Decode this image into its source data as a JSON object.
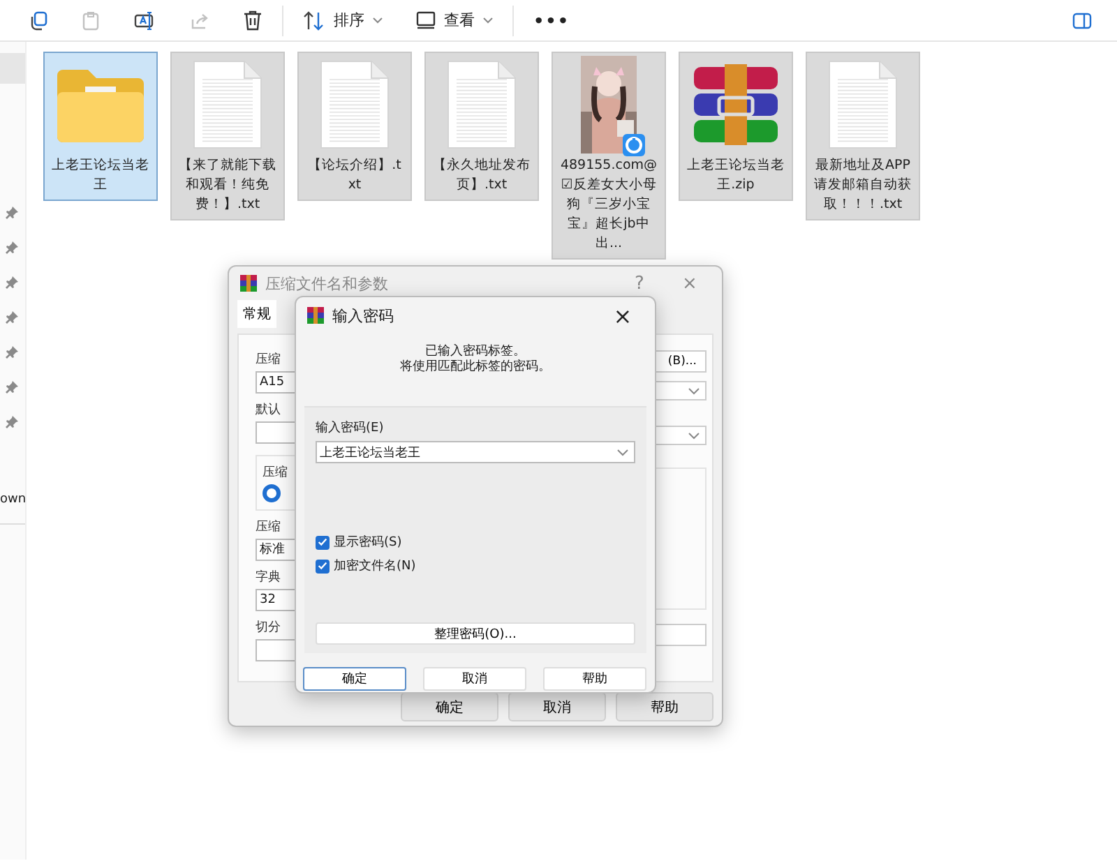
{
  "toolbar": {
    "items": [
      {
        "kind": "copy",
        "disabled": false
      },
      {
        "kind": "paste",
        "disabled": true
      },
      {
        "kind": "rename",
        "disabled": false
      },
      {
        "kind": "share",
        "disabled": true
      },
      {
        "kind": "delete",
        "disabled": false
      },
      {
        "kind": "sort",
        "label": "排序",
        "disabled": false
      },
      {
        "kind": "view",
        "label": "查看",
        "disabled": false
      },
      {
        "kind": "more",
        "label": "•••",
        "disabled": false
      }
    ],
    "details_pane": true
  },
  "sidebar": {
    "items": [
      {
        "pinned": true
      },
      {
        "pinned": true
      },
      {
        "pinned": true
      },
      {
        "pinned": true
      },
      {
        "pinned": true
      },
      {
        "pinned": true
      },
      {
        "pinned": true
      },
      {
        "label": "own",
        "pinned": false
      }
    ]
  },
  "files": [
    {
      "kind": "folder",
      "name": "上老王论坛当老王",
      "selected": true
    },
    {
      "kind": "text",
      "name": "【来了就能下载和观看！纯免费！】.txt",
      "selected": false
    },
    {
      "kind": "text",
      "name": "【论坛介绍】.txt",
      "selected": false
    },
    {
      "kind": "text",
      "name": "【永久地址发布页】.txt",
      "selected": false
    },
    {
      "kind": "video",
      "name": "489155.com@☑反差女大小母狗『三岁小宝宝』超长jb中出...",
      "selected": false
    },
    {
      "kind": "archive",
      "name": "上老王论坛当老王.zip",
      "selected": false
    },
    {
      "kind": "text",
      "name": "最新地址及APP请发邮箱自动获取！！！.txt",
      "selected": false
    }
  ],
  "archive_dialog": {
    "title": "压缩文件名和参数",
    "help": "?",
    "close": "×",
    "tab": "常规",
    "labels": [
      "压缩",
      "默认",
      "压缩",
      "压缩",
      "字典",
      "切分"
    ],
    "archive_name": "A15",
    "radio_checked": true,
    "method": "标准",
    "dictionary": "32",
    "browse": "(B)...",
    "buttons": [
      "确定",
      "取消",
      "帮助"
    ]
  },
  "password_dialog": {
    "title": "输入密码",
    "close": "×",
    "message": [
      "已输入密码标签。",
      "将使用匹配此标签的密码。"
    ],
    "field_label": "输入密码(E)",
    "password": "上老王论坛当老王",
    "checkboxes": [
      {
        "label": "显示密码(S)",
        "checked": true
      },
      {
        "label": "加密文件名(N)",
        "checked": true
      }
    ],
    "organize": "整理密码(O)...",
    "buttons": [
      {
        "label": "确定",
        "default": true
      },
      {
        "label": "取消",
        "default": false
      },
      {
        "label": "帮助",
        "default": false
      }
    ]
  }
}
